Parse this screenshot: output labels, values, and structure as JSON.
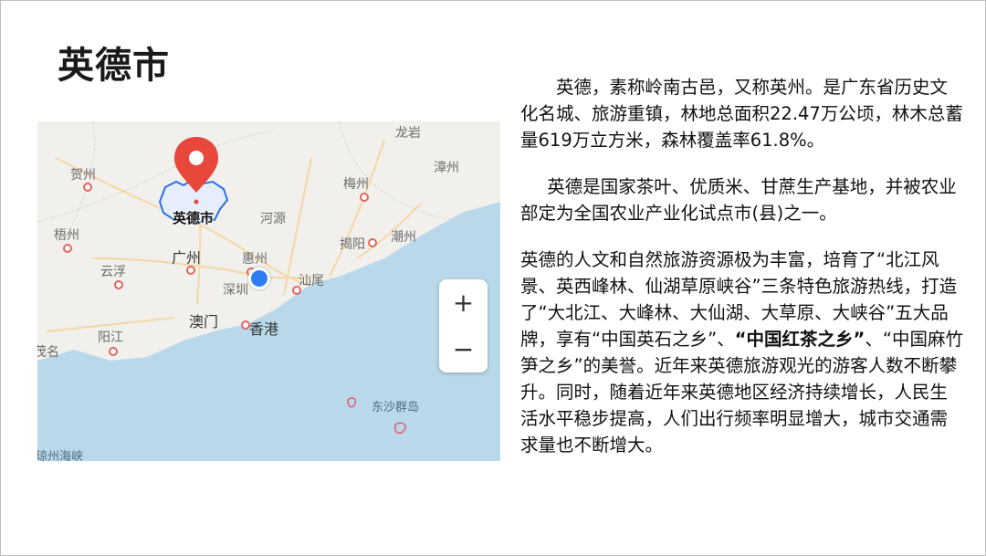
{
  "title": "英德市",
  "map": {
    "pin_label": "英德市",
    "cities": {
      "longyan": "龙岩",
      "hezhou": "贺州",
      "zhangzhou": "漳州",
      "meizhou": "梅州",
      "heyuan": "河源",
      "wuzhou": "梧州",
      "chaozhou": "潮州",
      "jieyang": "揭阳",
      "guangzhou": "广州",
      "huizhou": "惠州",
      "yunfu": "云浮",
      "shanwei": "汕尾",
      "shenzhen": "深圳",
      "aomen": "澳门",
      "xianggang": "香港",
      "yangjiang": "阳江",
      "maoming": "茂名",
      "dongsha": "东沙群岛",
      "qiongzhou": "琼州海峡"
    },
    "zoom_in": "+",
    "zoom_out": "−",
    "colors": {
      "land": "#f1f0ec",
      "sea": "#b9d9ea",
      "pin": "#e8473c",
      "location": "#2e7df6"
    }
  },
  "paragraphs": {
    "p1": "英德，素称岭南古邑，又称英州。是广东省历史文化名城、旅游重镇，林地总面积22.47万公顷，林木总蓄量619万立方米，森林覆盖率61.8%。",
    "p2": "英德是国家茶叶、优质米、甘蔗生产基地，并被农业部定为全国农业产业化试点市(县)之一。",
    "p3_a": "英德的人文和自然旅游资源极为丰富，培育了“北江风景、英西峰林、仙湖草原峡谷”三条特色旅游热线，打造了“大北江、大峰林、大仙湖、大草原、大峡谷”五大品牌，享有“中国英石之乡”、",
    "p3_bold": "“中国红茶之乡”",
    "p3_b": "、“中国麻竹笋之乡”的美誉。近年来英德旅游观光的游客人数不断攀升。同时，随着近年来英德地区经济持续增长，人民生活水平稳步提高，人们出行频率明显增大，城市交通需求量也不断增大。"
  }
}
